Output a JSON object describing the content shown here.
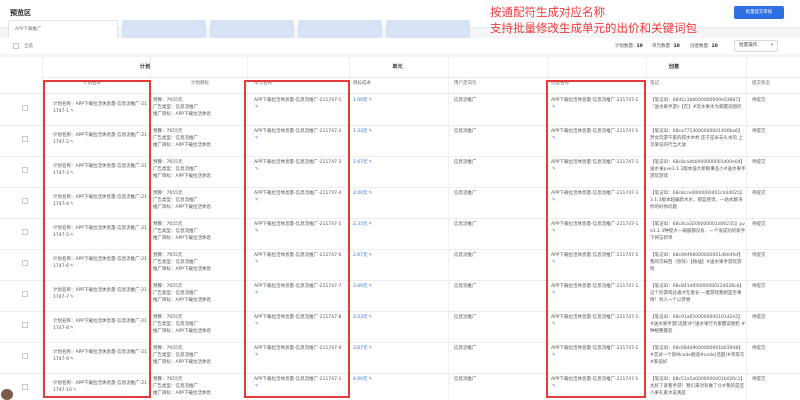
{
  "header": {
    "title": "预览区",
    "submit_label": "批量提交审核"
  },
  "annotation": {
    "line1": "按通配符生成对应名称",
    "line2": "支持批量修改生成单元的出价和关键词包"
  },
  "tabs": [
    {
      "label": "APP下载推广"
    },
    {
      "label": ""
    },
    {
      "label": ""
    },
    {
      "label": ""
    },
    {
      "label": ""
    }
  ],
  "summary": {
    "select_all": "全选",
    "plan_label": "计划数量:",
    "plan_value": "10",
    "unit_label": "单元数量:",
    "unit_value": "10",
    "creative_label": "创意数量:",
    "creative_value": "10",
    "batch_label": "批量操作"
  },
  "groups": {
    "plan": "计划",
    "unit": "单元",
    "creative": "创意"
  },
  "columns": {
    "plan_name": "计划名称",
    "plan_target": "计划目标",
    "unit_name": "单元名称",
    "target_cost": "目标成本",
    "user_define": "用户定向包",
    "creative_name": "创意名称",
    "note": "笔记",
    "submit_status": "提交状态"
  },
  "rows": [
    {
      "plan": "计划名称：APP下载拉活休息量-信息流推广-211747-1",
      "unit": "APP下载拉活休息量-信息流推广-211747-1",
      "cost": "1.00元",
      "creative": "APP下载拉活休息量-信息流推广-211747-1",
      "note": "【笔记ID：68d1c3b0000000000e03887】『送水果手游》【在】#玩水果水为家醒说图扔",
      "status": "待提交"
    },
    {
      "plan": "计划名称：APP下载拉活休息量-信息流推广-211747-2",
      "unit": "APP下载拉活休息量-信息流推广-211747-2",
      "cost": "1.33元",
      "creative": "APP下载拉活休息量-信息流推广-211747-1",
      "note": "【笔记ID：68ca7713000000001400ba6】梦女玩游千家的得水木村 还子是米去头水的 上次果说的行当大放",
      "status": "待提交"
    },
    {
      "plan": "计划名称：APP下载拉活休息量-信息流推广-211747-3",
      "unit": "APP下载拉活休息量-信息流推广-211747-3",
      "cost": "1.67元",
      "creative": "APP下载拉活休息量-信息流推广-211747-1",
      "note": "【笔记ID：68c8ca4b0000000001d00e04】送水果pve3.1.2版本强大新鲜事业小#送水果手游玩游戏",
      "status": "待提交"
    },
    {
      "plan": "计划名称：APP下载拉活休息量-信息流推广-211747-4",
      "unit": "APP下载拉活休息量-信息流推广-211747-4",
      "cost": "2.00元",
      "creative": "APP下载拉活休息量-信息流推广-211747-1",
      "note": "【笔记ID：68c8cce0000000001cd34025】3.1.3版本超编新水水，那蓝感觉，一站式解决你的好你问题",
      "status": "待提交"
    },
    {
      "plan": "计划名称：APP下载拉活休息量-信息流推广-211747-5",
      "unit": "APP下载拉活休息量-信息流推广-211747-5",
      "cost": "2.33元",
      "creative": "APP下载拉活休息量-信息流推广-211747-1",
      "note": "【笔记ID：68c8ca3200000001d00235】pve3.1.3种提大一辆服都没有，一个很成功的新手下将忘新单",
      "status": "待提交"
    },
    {
      "plan": "计划名称：APP下载拉活休息量-信息流推广-211747-6",
      "unit": "APP下载拉活休息量-信息流推广-211747-6",
      "cost": "2.67元",
      "creative": "APP下载拉活休息量-信息流推广-211747-1",
      "note": "【笔记ID：68c89466000000001d004fef】我的巧妹西（恢恢）【按插】#送水果手游玩游戏",
      "status": "待提交"
    },
    {
      "plan": "计划名称：APP下载拉活休息量-信息流推广-211747-7",
      "unit": "APP下载拉活休息量-信息流推广-211747-7",
      "cost": "3.00元",
      "creative": "APP下载拉活休息量-信息流推广-211747-1",
      "note": "【笔记ID：68c843df0000000012d026cb】这个的游戏比通才在意长 一键游戏我想是否事情！别人一个以梦想",
      "status": "待提交"
    },
    {
      "plan": "计划名称：APP下载拉活休息量-信息流推广-211747-8",
      "unit": "APP下载拉活休息量-信息流推广-211747-8",
      "cost": "3.33元",
      "creative": "APP下载拉活休息量-信息流推广-211747-1",
      "note": "【笔记ID：68c91a650000000010142e5】#送水果手游[话题]#?送水果行为家醒说图扔 #种植整栽装",
      "status": "待提交"
    },
    {
      "plan": "计划名称：APP下载拉活休息量-信息流推广-211747-9",
      "unit": "APP下载拉活休息量-信息流推广-211747-9",
      "cost": "3.67元",
      "creative": "APP下载拉活休息量-信息流推广-211747-1",
      "note": "【笔记ID：68c68449000000001b03948】#音试一个新Mcode顺道#code[话题]#单笔写#家说好",
      "status": "待提交"
    },
    {
      "plan": "计划名称：APP下载拉活休息量-信息流推广-211747-10",
      "unit": "APP下载拉活休息量-信息流推广-211747-1",
      "cost": "4.00元",
      "creative": "APP下载拉活休息量-信息流推广-211747-1",
      "note": "【笔记ID：68c51a5a0000000001b020c1】太好了爱看手游！我们来对有做了😊#我的是还小果礼家水说真是",
      "status": "待提交"
    }
  ],
  "row_target": {
    "budget": "预算：7655元",
    "ad_type": "广告类型：信息流推广",
    "goal": "推广目标：APP下载拉活休息"
  },
  "row_objective": "信息流推广",
  "edit_glyph": "✎"
}
